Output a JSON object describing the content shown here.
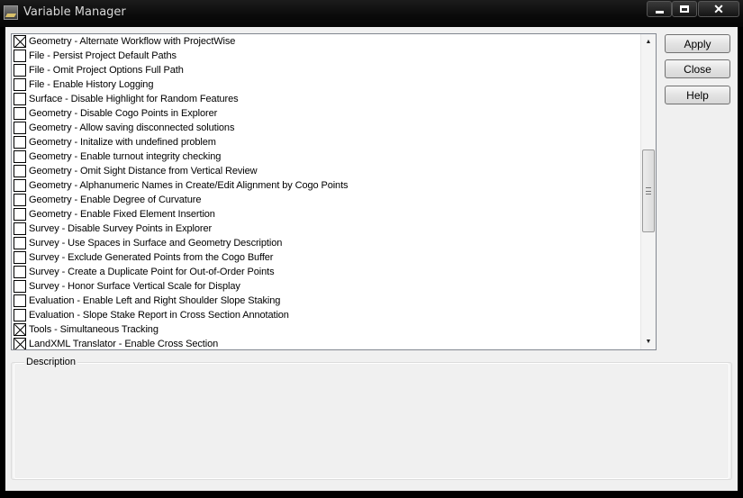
{
  "window": {
    "title": "Variable Manager"
  },
  "list": {
    "items": [
      {
        "label": "Geometry - Alternate Workflow with ProjectWise",
        "checked": true
      },
      {
        "label": "File - Persist Project Default Paths",
        "checked": false
      },
      {
        "label": "File - Omit Project Options Full Path",
        "checked": false
      },
      {
        "label": "File - Enable History Logging",
        "checked": false
      },
      {
        "label": "Surface - Disable Highlight for Random Features",
        "checked": false
      },
      {
        "label": "Geometry - Disable Cogo Points in Explorer",
        "checked": false
      },
      {
        "label": "Geometry - Allow saving disconnected solutions",
        "checked": false
      },
      {
        "label": "Geometry - Initalize with undefined problem",
        "checked": false
      },
      {
        "label": "Geometry - Enable turnout integrity checking",
        "checked": false
      },
      {
        "label": "Geometry - Omit Sight Distance from Vertical Review",
        "checked": false
      },
      {
        "label": "Geometry - Alphanumeric Names in Create/Edit Alignment by Cogo Points",
        "checked": false
      },
      {
        "label": "Geometry - Enable Degree of Curvature",
        "checked": false
      },
      {
        "label": "Geometry - Enable Fixed Element Insertion",
        "checked": false
      },
      {
        "label": "Survey - Disable Survey Points in Explorer",
        "checked": false
      },
      {
        "label": "Survey - Use Spaces in Surface and Geometry Description",
        "checked": false
      },
      {
        "label": "Survey - Exclude Generated Points from the Cogo Buffer",
        "checked": false
      },
      {
        "label": "Survey - Create a Duplicate Point for Out-of-Order Points",
        "checked": false
      },
      {
        "label": "Survey - Honor Surface Vertical Scale for Display",
        "checked": false
      },
      {
        "label": "Evaluation - Enable Left and Right Shoulder Slope Staking",
        "checked": false
      },
      {
        "label": "Evaluation - Slope Stake Report in Cross Section Annotation",
        "checked": false
      },
      {
        "label": "Tools - Simultaneous Tracking",
        "checked": true
      },
      {
        "label": "LandXML Translator - Enable Cross Section",
        "checked": true
      }
    ]
  },
  "buttons": {
    "apply": "Apply",
    "close": "Close",
    "help": "Help"
  },
  "description": {
    "label": "Description"
  }
}
